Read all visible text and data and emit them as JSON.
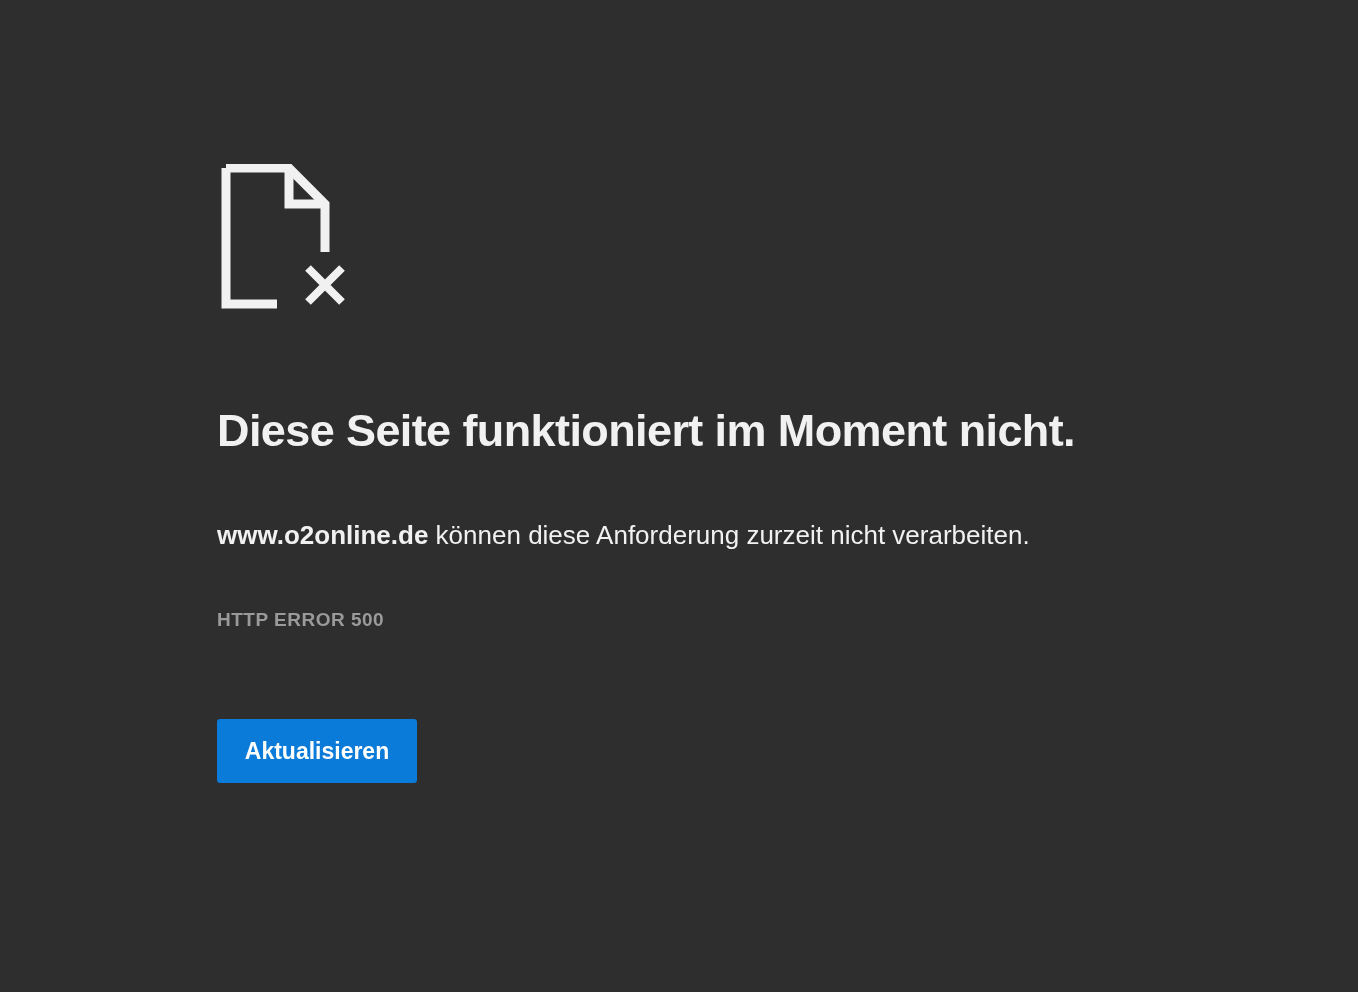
{
  "heading": "Diese Seite funktioniert im Moment nicht.",
  "message": "**www.o2online.de** können diese Anforderung zurzeit nicht verarbeiten.",
  "error_code": "HTTP ERROR 500",
  "buttons": [
    {
      "label": "Aktualisieren"
    }
  ]
}
